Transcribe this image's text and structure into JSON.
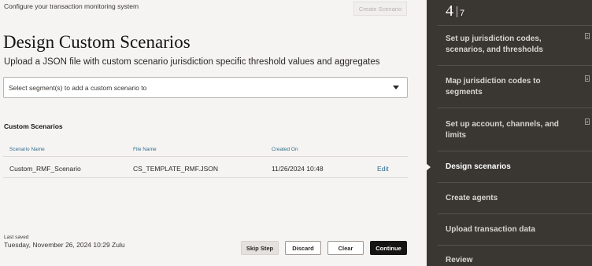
{
  "header": {
    "context_text": "Configure your transaction monitoring system",
    "create_scenario_label": "Create Scenario"
  },
  "page": {
    "title": "Design Custom Scenarios",
    "subtitle": "Upload a JSON file with custom scenario jurisdiction specific threshold values and aggregates"
  },
  "segment_select": {
    "placeholder": "Select segment(s) to add a custom scenario to"
  },
  "custom_scenarios": {
    "section_title": "Custom Scenarios",
    "columns": [
      "Scenario Name",
      "File Name",
      "Created On",
      ""
    ],
    "rows": [
      {
        "scenario_name": "Custom_RMF_Scenario",
        "file_name": "CS_TEMPLATE_RMF.JSON",
        "created_on": "11/26/2024 10:48",
        "action": "Edit"
      }
    ]
  },
  "footer": {
    "last_saved_label": "Last saved",
    "last_saved_value": "Tuesday, November 26, 2024 10:29 Zulu",
    "skip_label": "Skip Step",
    "discard_label": "Discard",
    "clear_label": "Clear",
    "continue_label": "Continue"
  },
  "sidebar": {
    "current_step": "4",
    "total_steps": "7",
    "steps": [
      {
        "label": "Set up jurisdiction codes, scenarios, and thresholds",
        "icon": "document-icon"
      },
      {
        "label": "Map jurisdiction codes to segments",
        "icon": "document-icon"
      },
      {
        "label": "Set up account, channels, and limits",
        "icon": "document-icon"
      },
      {
        "label": "Design scenarios",
        "active": true
      },
      {
        "label": "Create agents"
      },
      {
        "label": "Upload transaction data"
      },
      {
        "label": "Review"
      }
    ]
  }
}
